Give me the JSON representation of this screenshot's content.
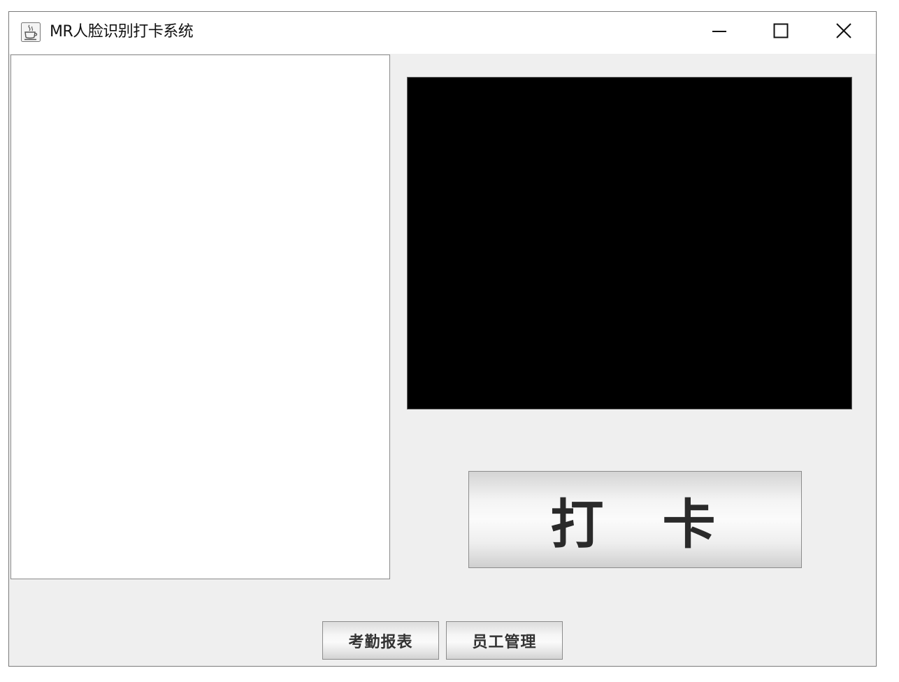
{
  "window": {
    "title": "MR人脸识别打卡系统",
    "app_icon": "java-coffee-icon",
    "controls": {
      "minimize_icon": "minimize-icon",
      "maximize_icon": "maximize-icon",
      "close_icon": "close-icon"
    }
  },
  "main": {
    "punch_button_label": "打卡"
  },
  "footer": {
    "attendance_report_label": "考勤报表",
    "staff_management_label": "员工管理"
  }
}
